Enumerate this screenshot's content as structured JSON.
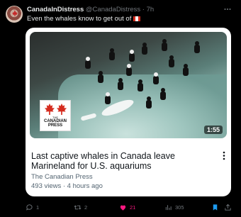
{
  "post": {
    "display_name": "CanadaInDistress",
    "handle": "@CanadaDistress",
    "separator": "·",
    "time": "7h",
    "text": "Even the whales know to get out of",
    "flag_icon": "canada-flag-icon"
  },
  "card": {
    "duration": "1:55",
    "logo": {
      "the": "THE",
      "line1": "CANADIAN",
      "line2": "PRESS"
    },
    "title": "Last captive whales in Canada leave Marineland for U.S. aquariums",
    "source": "The Canadian Press",
    "meta": "493 views · 4 hours ago"
  },
  "actions": {
    "replies": "1",
    "reposts": "2",
    "likes": "21",
    "views": "305",
    "like_color": "#f91880",
    "bookmark_color": "#1d9bf0"
  }
}
